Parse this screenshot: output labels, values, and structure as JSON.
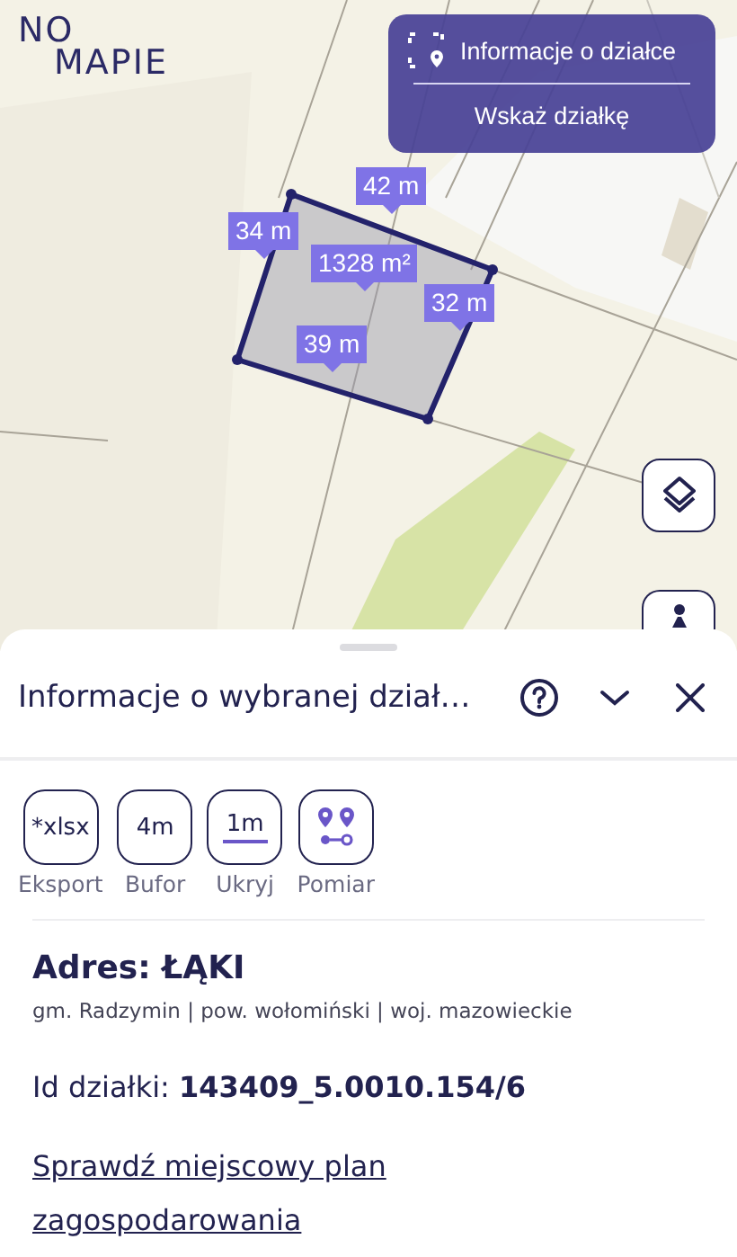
{
  "logo": {
    "line1": "NO",
    "line2": "MAPIE"
  },
  "map_menu": {
    "items": [
      {
        "label": "Informacje o działce",
        "kind": "info"
      },
      {
        "label": "Wskaż działkę",
        "kind": "plain"
      }
    ]
  },
  "measurements": [
    {
      "label": "42 m"
    },
    {
      "label": "34 m"
    },
    {
      "label": "1328 m²"
    },
    {
      "label": "32 m"
    },
    {
      "label": "39 m"
    }
  ],
  "map_buttons": [
    {
      "kind": "layers"
    },
    {
      "kind": "person"
    }
  ],
  "sheet": {
    "title": "Informacje o wybranej dział…",
    "tools": [
      {
        "kind": "text",
        "icon_text": "*xlsx",
        "label": "Eksport"
      },
      {
        "kind": "text",
        "icon_text": "4m",
        "label": "Bufor"
      },
      {
        "kind": "ruler",
        "icon_text": "1m",
        "label": "Ukryj"
      },
      {
        "kind": "pins",
        "label": "Pomiar"
      }
    ],
    "address": "Adres: ŁĄKI",
    "region": "gm. Radzymin | pow. wołomiński | woj. mazowieckie",
    "parcel_id_label": "Id działki:",
    "parcel_id": "143409_5.0010.154/6",
    "plan_link": "Sprawdź miejscowy plan zagospodarowania"
  }
}
